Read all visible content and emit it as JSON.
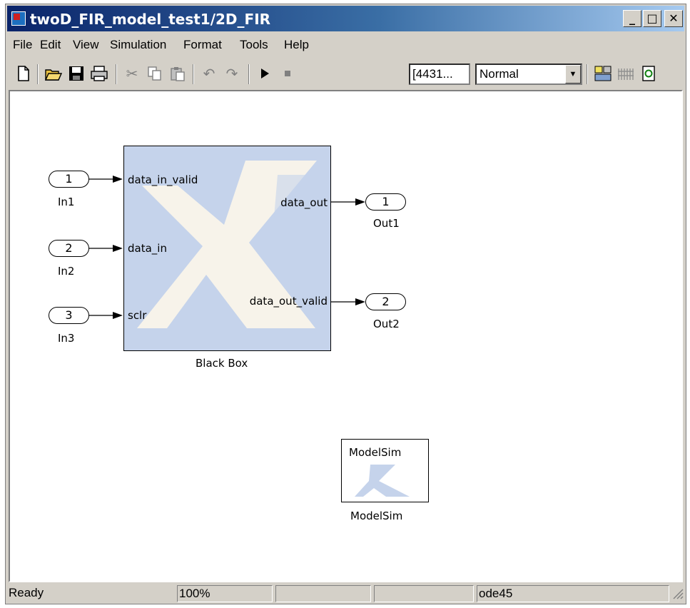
{
  "window": {
    "title": "twoD_FIR_model_test1/2D_FIR",
    "controls": {
      "minimize": "_",
      "maximize": "□",
      "close": "✕"
    }
  },
  "menu": [
    "File",
    "Edit",
    "View",
    "Simulation",
    "Format",
    "Tools",
    "Help"
  ],
  "toolbar": {
    "icons": [
      "new-model-icon",
      "open-icon",
      "save-icon",
      "print-icon",
      "cut-icon",
      "copy-icon",
      "paste-icon",
      "undo-icon",
      "redo-icon",
      "start-simulation-icon",
      "stop-simulation-icon",
      "build-icon",
      "library-browser-icon",
      "refresh-icon"
    ],
    "stop_time": "[4431...",
    "sim_mode": "Normal"
  },
  "model": {
    "inports": [
      {
        "number": "1",
        "name": "In1"
      },
      {
        "number": "2",
        "name": "In2"
      },
      {
        "number": "3",
        "name": "In3"
      }
    ],
    "outports": [
      {
        "number": "1",
        "name": "Out1"
      },
      {
        "number": "2",
        "name": "Out2"
      }
    ],
    "black_box": {
      "name": "Black Box",
      "inputs": [
        "data_in_valid",
        "data_in",
        "sclr"
      ],
      "outputs": [
        "data_out",
        "data_out_valid"
      ]
    },
    "modelsim": {
      "inner_label": "ModelSim",
      "name": "ModelSim"
    }
  },
  "status": {
    "state": "Ready",
    "zoom": "100%",
    "field3": "",
    "field4": "",
    "solver": "ode45"
  },
  "colors": {
    "title_gradient_start": "#0a246a",
    "title_gradient_end": "#a6caf0",
    "block_fill": "#c5d3eb",
    "logo_fill": "#f7f3ea",
    "chrome": "#d4d0c8"
  }
}
